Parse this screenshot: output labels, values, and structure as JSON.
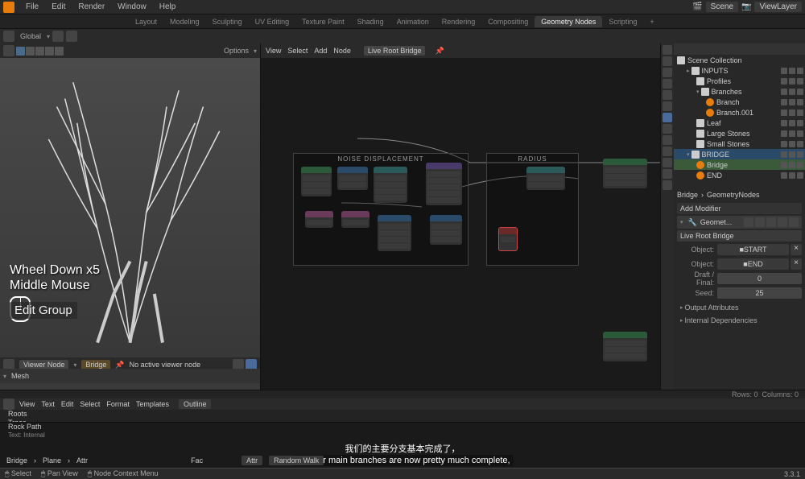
{
  "menu": {
    "file": "File",
    "edit": "Edit",
    "render": "Render",
    "window": "Window",
    "help": "Help"
  },
  "workspaces": {
    "layout": "Layout",
    "modeling": "Modeling",
    "sculpting": "Sculpting",
    "uv": "UV Editing",
    "texture": "Texture Paint",
    "shading": "Shading",
    "animation": "Animation",
    "rendering": "Rendering",
    "compositing": "Compositing",
    "geometry": "Geometry Nodes",
    "scripting": "Scripting"
  },
  "scene": {
    "name": "Scene",
    "layer": "ViewLayer"
  },
  "toolbar": {
    "global": "Global",
    "options": "Options"
  },
  "node_header": {
    "view": "View",
    "select": "Select",
    "add": "Add",
    "node": "Node",
    "group": "Live Root Bridge"
  },
  "frames": {
    "noise": "NOISE DISPLACEMENT",
    "radius": "RADIUS"
  },
  "viewport": {
    "wheel": "Wheel Down x5",
    "middle": "Middle Mouse",
    "edit_group": "Edit Group",
    "viewer_node": "Viewer Node",
    "bridge": "Bridge",
    "no_viewer": "No active viewer node",
    "mesh": "Mesh",
    "rows": "Rows: 0",
    "cols": "Columns: 0"
  },
  "outliner": {
    "scene_collection": "Scene Collection",
    "inputs": "INPUTS",
    "profiles": "Profiles",
    "branches": "Branches",
    "branch": "Branch",
    "branch001": "Branch.001",
    "leaf": "Leaf",
    "large_stones": "Large Stones",
    "small_stones": "Small Stones",
    "bridge": "BRIDGE",
    "bridge_obj": "Bridge",
    "end": "END"
  },
  "properties": {
    "bridge": "Bridge",
    "geonodes": "GeometryNodes",
    "add_modifier": "Add Modifier",
    "geomod": "Geomet...",
    "nodegroup": "Live Root Bridge",
    "object1_label": "Object:",
    "object1_val": "START",
    "object2_label": "Object:",
    "object2_val": "END",
    "draft_label": "Draft / Final:",
    "draft_val": "0",
    "seed_label": "Seed:",
    "seed_val": "25",
    "output_attrs": "Output Attributes",
    "internal_deps": "Internal Dependencies"
  },
  "text_editor": {
    "view": "View",
    "text": "Text",
    "edit": "Edit",
    "select": "Select",
    "format": "Format",
    "templates": "Templates",
    "outline": "Outline",
    "items": [
      "Roots",
      "Trees",
      "Rock Path"
    ],
    "status": "Text: Internal"
  },
  "breadcrumb": {
    "bridge": "Bridge",
    "plane": "Plane",
    "attr": "Attr",
    "attr2": "Attr",
    "fac": "Fac",
    "random_walk": "Random Walk"
  },
  "subtitle": {
    "cn": "我们的主要分支基本完成了，",
    "en": "And our main branches are now pretty much complete,"
  },
  "statusbar": {
    "select": "Select",
    "pan": "Pan View",
    "context": "Node Context Menu",
    "version": "3.3.1"
  }
}
